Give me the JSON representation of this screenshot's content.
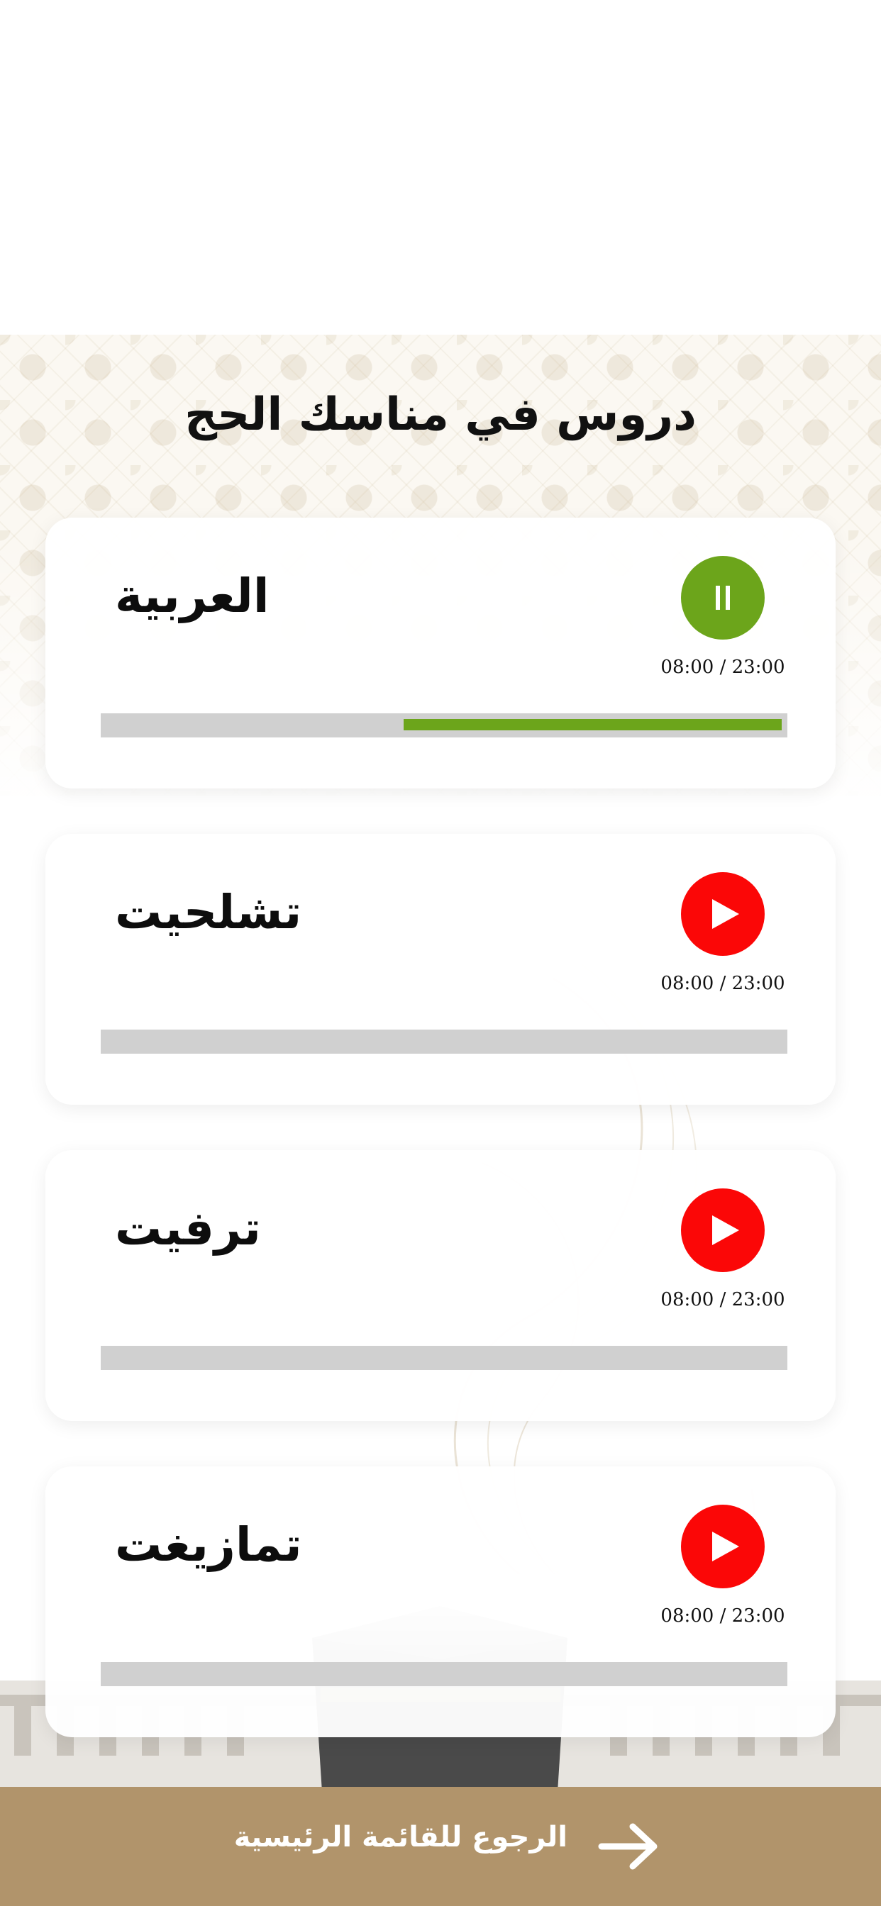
{
  "page": {
    "title": "دروس في مناسك الحج"
  },
  "lessons": [
    {
      "label": "العربية",
      "time": "08:00 / 23:00",
      "state": "playing",
      "button_icon": "pause-icon",
      "progress": 0.56
    },
    {
      "label": "تشلحيت",
      "time": "08:00 / 23:00",
      "state": "paused",
      "button_icon": "play-icon",
      "progress": 0
    },
    {
      "label": "ترفيت",
      "time": "08:00 / 23:00",
      "state": "paused",
      "button_icon": "play-icon",
      "progress": 0
    },
    {
      "label": "تمازيغت",
      "time": "08:00 / 23:00",
      "state": "paused",
      "button_icon": "play-icon",
      "progress": 0
    }
  ],
  "footer": {
    "back_label": "الرجوع للقائمة الرئيسية",
    "back_icon": "arrow-right-icon"
  },
  "colors": {
    "playing": "#6ca51b",
    "paused": "#fb0707",
    "track": "#d0d0d0",
    "footer": "#b1946b"
  }
}
